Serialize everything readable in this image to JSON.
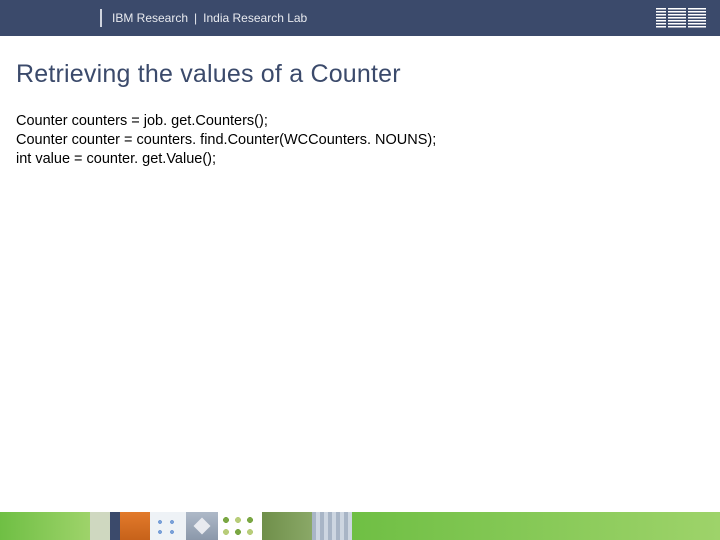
{
  "header": {
    "org": "IBM Research",
    "separator": "|",
    "lab": "India Research Lab",
    "logo_name": "ibm-logo"
  },
  "slide": {
    "title": "Retrieving the values of a Counter",
    "code_lines": [
      "Counter counters = job. get.Counters();",
      "Counter counter = counters. find.Counter(WCCounters. NOUNS);",
      "int value = counter. get.Value();"
    ]
  }
}
